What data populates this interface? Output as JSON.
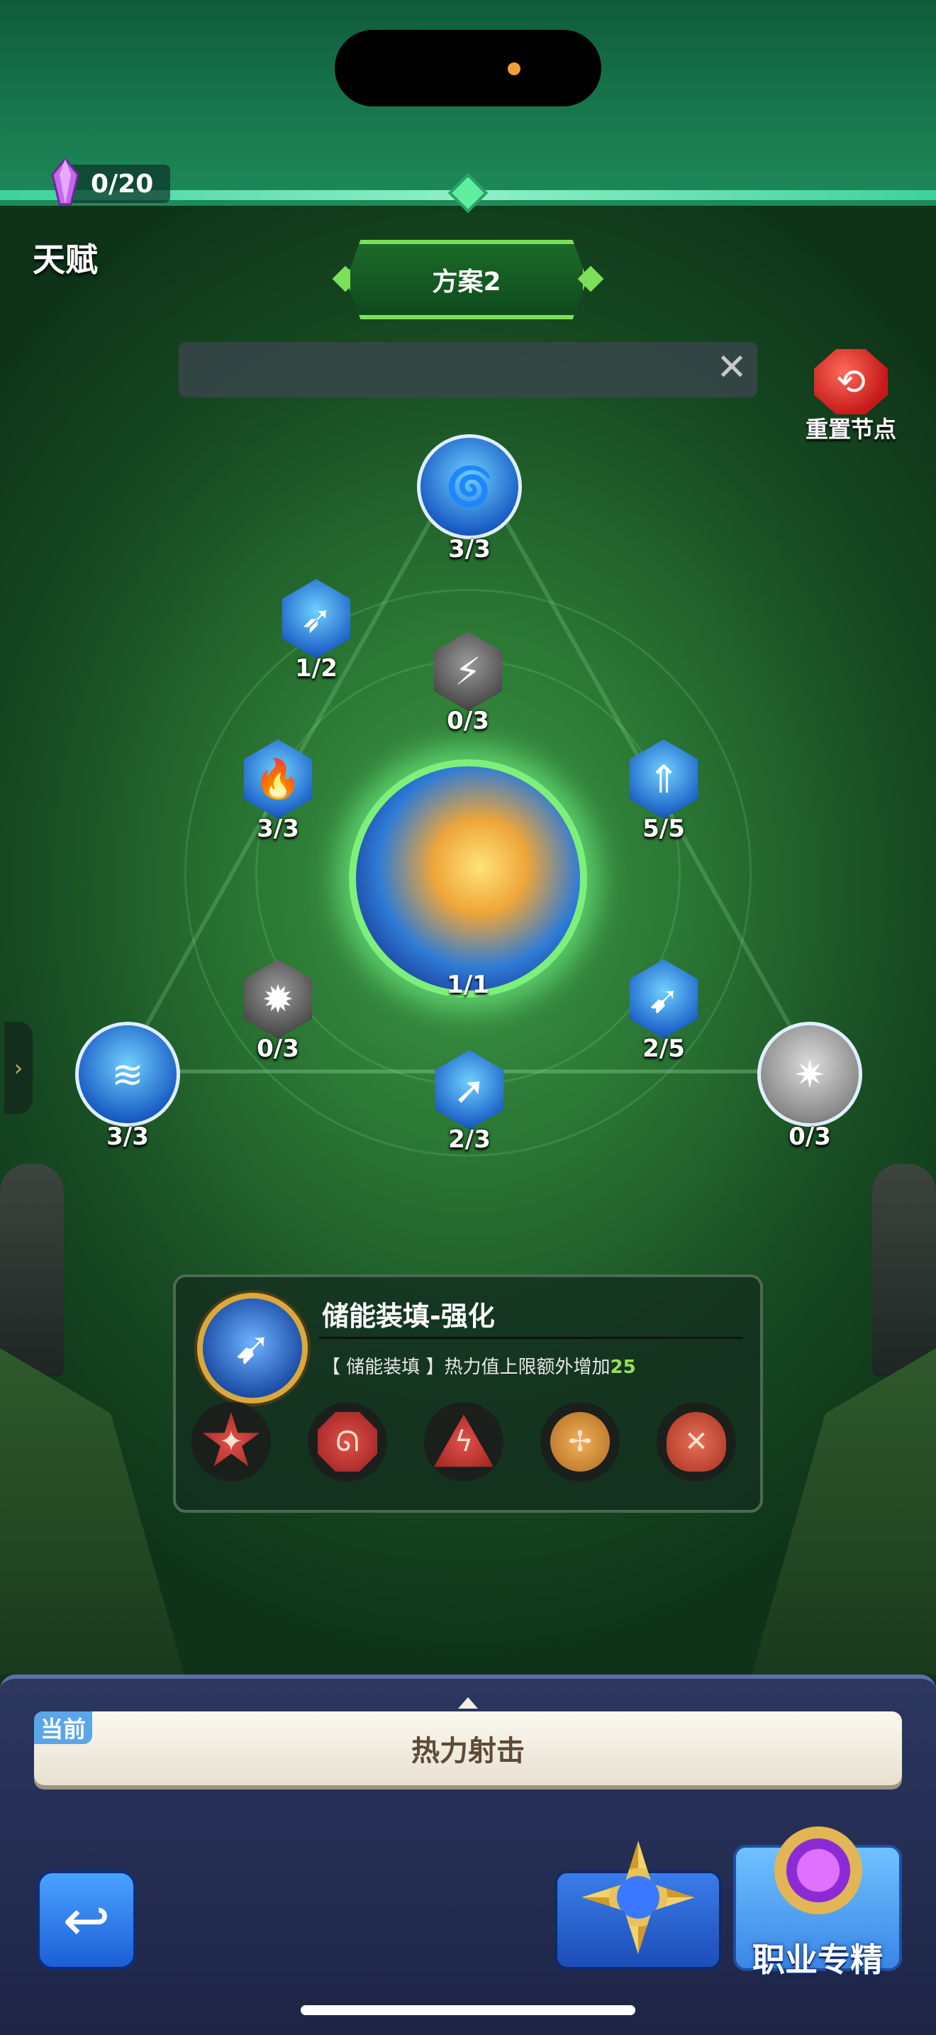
{
  "header": {
    "currency_value": "0/20",
    "title": "天赋",
    "plan_label": "方案2",
    "search_close_glyph": "✕",
    "reset_label": "重置节点"
  },
  "tree": {
    "core_count": "1/1",
    "nodes": [
      {
        "id": "top",
        "count": "3/3",
        "icon": "wind-swirl-icon"
      },
      {
        "id": "upper-left",
        "count": "1/2",
        "icon": "piercing-arrow-icon"
      },
      {
        "id": "upper-center",
        "count": "0/3",
        "icon": "lightning-bolt-icon"
      },
      {
        "id": "mid-left",
        "count": "3/3",
        "icon": "blue-flame-icon"
      },
      {
        "id": "mid-right",
        "count": "5/5",
        "icon": "arrow-burst-icon"
      },
      {
        "id": "lower-left",
        "count": "0/3",
        "icon": "spiked-shell-icon"
      },
      {
        "id": "lower-right",
        "count": "2/5",
        "icon": "charge-load-icon"
      },
      {
        "id": "far-left",
        "count": "3/3",
        "icon": "vortex-icon"
      },
      {
        "id": "bottom",
        "count": "2/3",
        "icon": "arrow-strike-icon"
      },
      {
        "id": "far-right",
        "count": "0/3",
        "icon": "shatter-icon"
      }
    ]
  },
  "skill_panel": {
    "name": "储能装填-强化",
    "desc_prefix": "【 储能装填 】热力值上限额外增加",
    "desc_value": "25",
    "icon": "charge-load-icon",
    "runes": [
      "star-rune-icon",
      "octagon-rune-icon",
      "triangle-rune-icon",
      "shuriken-rune-icon",
      "shield-rune-icon"
    ]
  },
  "bottom_bar": {
    "current_tag": "当前",
    "current_skill": "热力射击",
    "back_glyph": "↩",
    "spec_label": "职业专精"
  },
  "colors": {
    "accent_green": "#7ee05a",
    "desc_highlight": "#9ae05a",
    "node_blue": "#1b5fc6",
    "node_grey": "#4a4a4a"
  }
}
